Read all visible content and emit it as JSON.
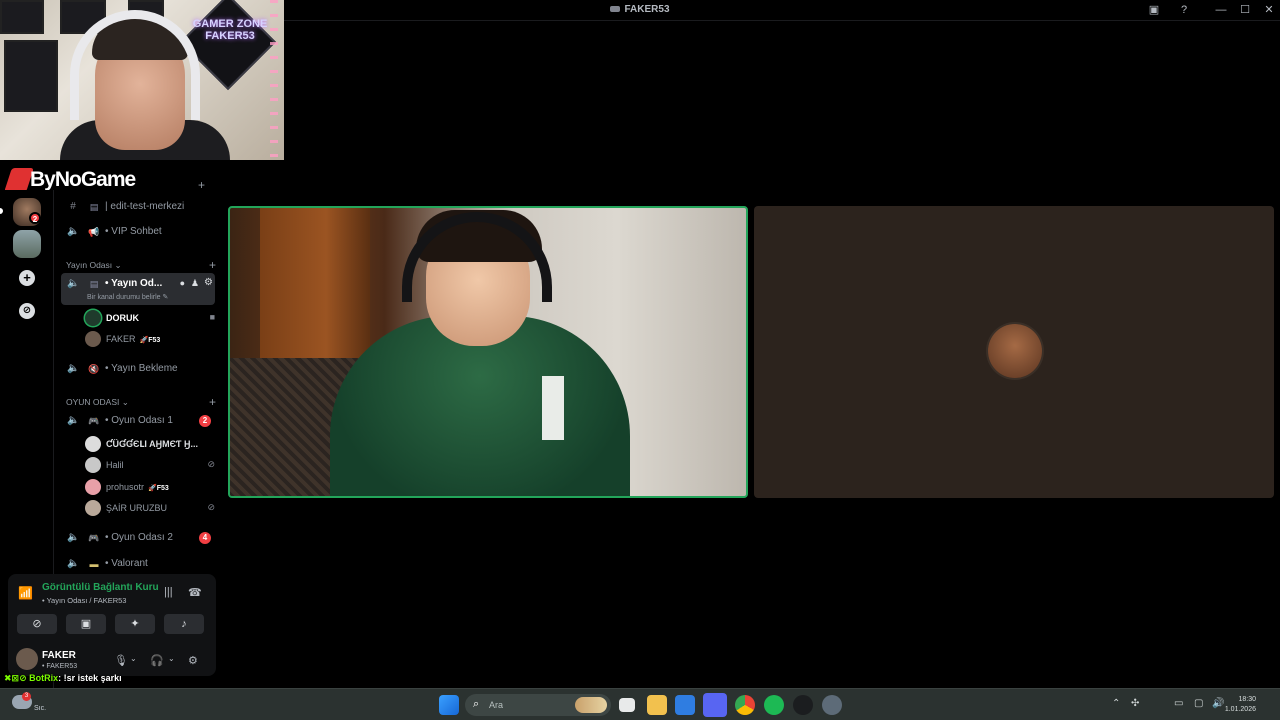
{
  "window": {
    "title": "FAKER53"
  },
  "overlay": {
    "brand": "ByNoGame",
    "webcam_neon": "GAMER ZONE FAKER53"
  },
  "rail": {
    "server_badge": "2",
    "add_icon": "+",
    "discover_icon": "compass-icon"
  },
  "channels": {
    "top_items": [
      {
        "label": "| edit-test-merkezi",
        "kind": "text"
      },
      {
        "label": "• VIP Sohbet",
        "kind": "voice"
      }
    ],
    "category1": {
      "name": "Yayın Odası ⌄"
    },
    "active_channel": {
      "label": "• Yayın Od...",
      "status": "Bir kanal durumu belirle ✎"
    },
    "active_users": [
      {
        "name": "DORUK",
        "tag": ""
      },
      {
        "name": "FAKER",
        "tag": "🚀F53"
      }
    ],
    "bekleme": {
      "label": "• Yayın Bekleme"
    },
    "category2": {
      "name": "OYUN ODASI ⌄"
    },
    "oyun1": {
      "label": "• Oyun Odası 1",
      "badge": "2"
    },
    "oyun1_users": [
      {
        "name": "ƇÜƓƓЄԼƖ AӇMЄƬ Ӈ...",
        "tag": ""
      },
      {
        "name": "Halil",
        "tag": ""
      },
      {
        "name": "prohusotr",
        "tag": "🚀F53"
      },
      {
        "name": "ŞAİR URUZBU",
        "tag": ""
      }
    ],
    "oyun2": {
      "label": "• Oyun Odası 2",
      "badge": "4"
    },
    "valorant": {
      "label": "• Valorant"
    }
  },
  "voice": {
    "status": "Görüntülü Bağlantı Kuru",
    "location": "• Yayın Odası / FAKER53"
  },
  "user": {
    "name": "FAKER",
    "sub": "• FAKER53"
  },
  "chat_overlay": {
    "prefix": "BotRix",
    "message": ": !sr istek şarkı"
  },
  "taskbar": {
    "weather_badge": "3",
    "weather_text": "Sıc.",
    "search_placeholder": "Ara",
    "time": "18:30",
    "date": "1.01.2026"
  },
  "colors": {
    "accent_green": "#23a55a",
    "badge_red": "#f23f43",
    "sidebar_bg": "#000000"
  }
}
